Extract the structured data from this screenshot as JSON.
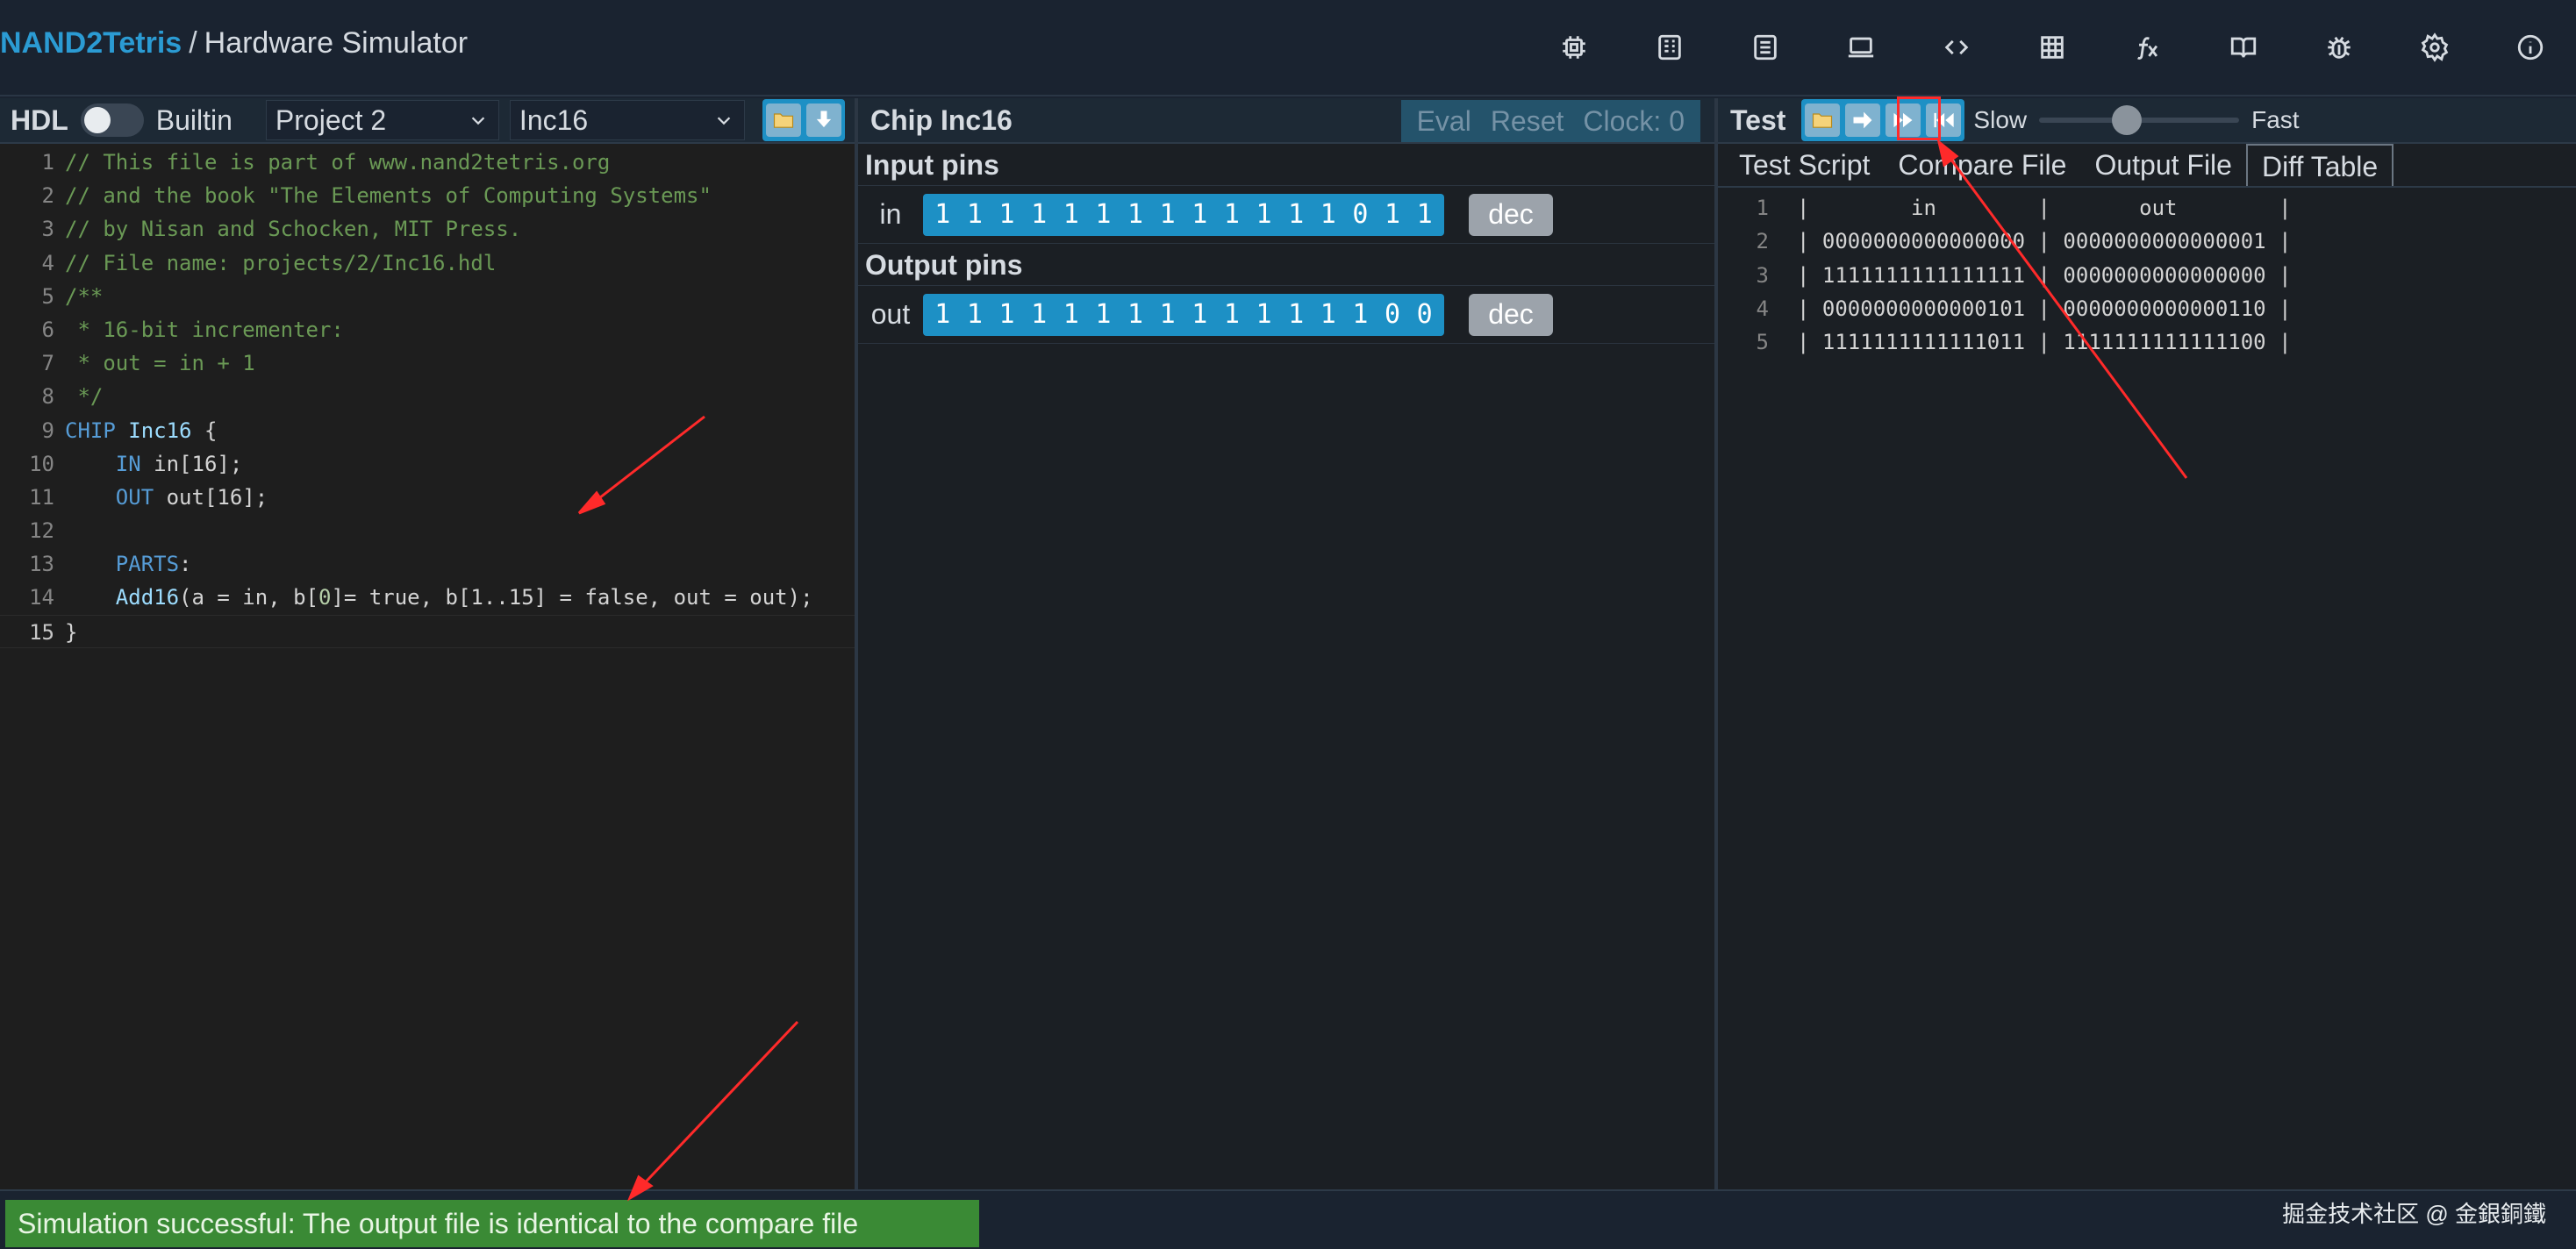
{
  "header": {
    "brand": "NAND2Tetris",
    "separator": "/",
    "app_title": "Hardware Simulator",
    "icons": [
      "chip-icon",
      "cpu-icon",
      "list-icon",
      "monitor-icon",
      "code-icon",
      "grid-icon",
      "function-icon",
      "book-icon",
      "bug-icon",
      "settings-icon",
      "info-icon"
    ]
  },
  "hdl_panel": {
    "title": "HDL",
    "toggle_label": "Builtin",
    "project_select": "Project 2",
    "chip_select": "Inc16",
    "code_lines": [
      {
        "n": "1",
        "parts": [
          [
            "cmt",
            "// This file is part of www.nand2tetris.org"
          ]
        ]
      },
      {
        "n": "2",
        "parts": [
          [
            "cmt",
            "// and the book \"The Elements of Computing Systems\""
          ]
        ]
      },
      {
        "n": "3",
        "parts": [
          [
            "cmt",
            "// by Nisan and Schocken, MIT Press."
          ]
        ]
      },
      {
        "n": "4",
        "parts": [
          [
            "cmt",
            "// File name: projects/2/Inc16.hdl"
          ]
        ]
      },
      {
        "n": "5",
        "parts": [
          [
            "cmt",
            "/**"
          ]
        ]
      },
      {
        "n": "6",
        "parts": [
          [
            "cmt",
            " * 16-bit incrementer:"
          ]
        ]
      },
      {
        "n": "7",
        "parts": [
          [
            "cmt",
            " * out = in + 1"
          ]
        ]
      },
      {
        "n": "8",
        "parts": [
          [
            "cmt",
            " */"
          ]
        ]
      },
      {
        "n": "9",
        "parts": [
          [
            "kw",
            "CHIP "
          ],
          [
            "id",
            "Inc16"
          ],
          [
            "tx",
            " {"
          ]
        ]
      },
      {
        "n": "10",
        "parts": [
          [
            "tx",
            "    "
          ],
          [
            "kw",
            "IN"
          ],
          [
            "tx",
            " in[16];"
          ]
        ]
      },
      {
        "n": "11",
        "parts": [
          [
            "tx",
            "    "
          ],
          [
            "kw",
            "OUT"
          ],
          [
            "tx",
            " out[16];"
          ]
        ]
      },
      {
        "n": "12",
        "parts": [
          [
            "tx",
            ""
          ]
        ]
      },
      {
        "n": "13",
        "parts": [
          [
            "tx",
            "    "
          ],
          [
            "kw",
            "PARTS"
          ],
          [
            "tx",
            ":"
          ]
        ]
      },
      {
        "n": "14",
        "parts": [
          [
            "tx",
            "    "
          ],
          [
            "id",
            "Add16"
          ],
          [
            "tx",
            "(a = in, b["
          ],
          [
            "num",
            "0"
          ],
          [
            "tx",
            "]= true, b[1..15] = false, out = out);"
          ]
        ]
      },
      {
        "n": "15",
        "parts": [
          [
            "tx",
            "}"
          ]
        ]
      }
    ]
  },
  "chip_panel": {
    "title": "Chip Inc16",
    "eval": "Eval",
    "reset": "Reset",
    "clock": "Clock: 0",
    "input_header": "Input pins",
    "output_header": "Output pins",
    "input_pin": {
      "name": "in",
      "bits": [
        "1",
        "1",
        "1",
        "1",
        "1",
        "1",
        "1",
        "1",
        "1",
        "1",
        "1",
        "1",
        "1",
        "0",
        "1",
        "1"
      ],
      "format": "dec"
    },
    "output_pin": {
      "name": "out",
      "bits": [
        "1",
        "1",
        "1",
        "1",
        "1",
        "1",
        "1",
        "1",
        "1",
        "1",
        "1",
        "1",
        "1",
        "1",
        "0",
        "0"
      ],
      "format": "dec"
    }
  },
  "test_panel": {
    "title": "Test",
    "slow": "Slow",
    "fast": "Fast",
    "speed_fraction": 0.44,
    "tabs": [
      "Test Script",
      "Compare File",
      "Output File",
      "Diff Table"
    ],
    "active_tab": "Diff Table",
    "diff_lines": [
      {
        "n": "1",
        "text": "|        in        |       out        |"
      },
      {
        "n": "2",
        "text": "| 0000000000000000 | 0000000000000001 |"
      },
      {
        "n": "3",
        "text": "| 1111111111111111 | 0000000000000000 |"
      },
      {
        "n": "4",
        "text": "| 0000000000000101 | 0000000000000110 |"
      },
      {
        "n": "5",
        "text": "| 1111111111111011 | 1111111111111100 |"
      }
    ]
  },
  "status": {
    "message": "Simulation successful: The output file is identical to the compare file",
    "watermark": "掘金技术社区 @ 金銀銅鐵"
  },
  "colors": {
    "accent": "#1d90c5",
    "brand": "#2b9bd3",
    "success": "#3a8a35",
    "annotation": "#ff2a2a"
  }
}
